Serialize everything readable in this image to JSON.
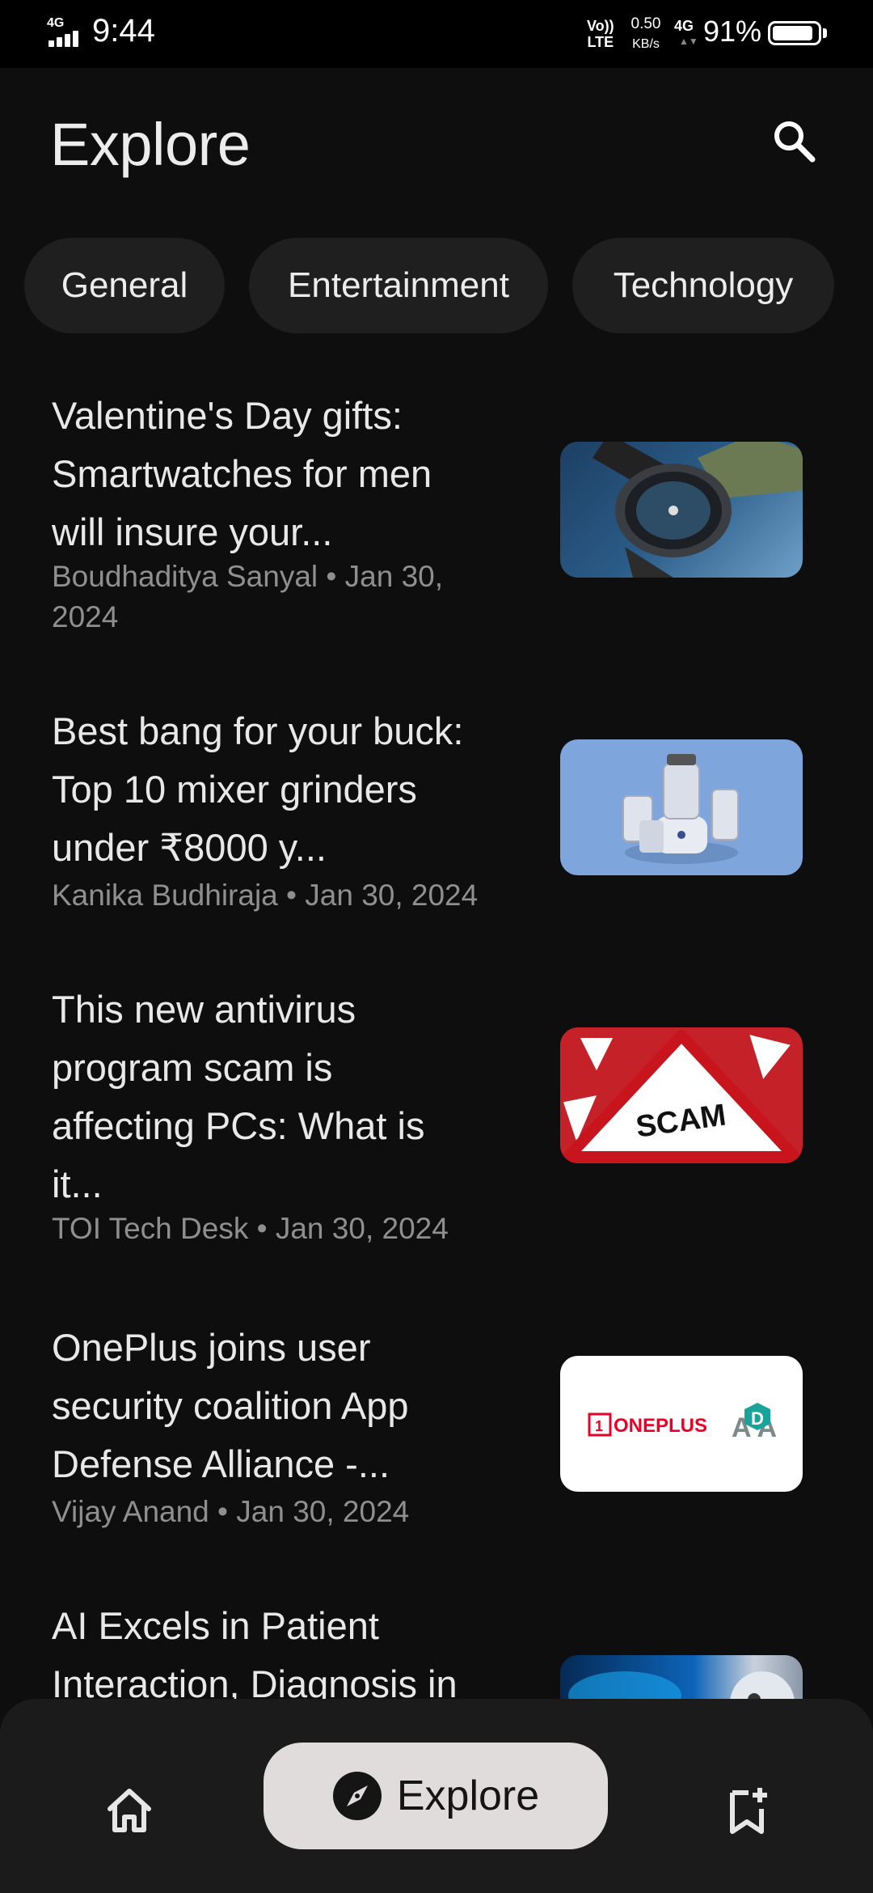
{
  "status_bar": {
    "network": "4G",
    "time": "9:44",
    "volte_top": "Vo))",
    "volte_bottom": "LTE",
    "speed_value": "0.50",
    "speed_unit": "KB/s",
    "network2": "4G",
    "battery_percent": "91%",
    "battery_level": 0.91
  },
  "header": {
    "title": "Explore",
    "search_icon": "search-icon"
  },
  "categories": [
    "General",
    "Entertainment",
    "Technology"
  ],
  "articles": [
    {
      "title_lines": [
        "Valentine's Day gifts:",
        "Smartwatches for men",
        "will insure your..."
      ],
      "meta_lines": [
        "Boudhaditya Sanyal • Jan 30,",
        "2024"
      ],
      "thumb": "smartwatch-image"
    },
    {
      "title_lines": [
        "Best bang for your buck:",
        "Top 10 mixer grinders",
        "under ₹8000 y..."
      ],
      "meta_lines": [
        "Kanika Budhiraja • Jan 30, 2024"
      ],
      "thumb": "mixer-grinder-image"
    },
    {
      "title_lines": [
        "This new antivirus",
        "program scam is",
        "affecting PCs: What is",
        "it..."
      ],
      "meta_lines": [
        "TOI Tech Desk • Jan 30, 2024"
      ],
      "thumb": "scam-sign-image",
      "thumb_text": "SCAM"
    },
    {
      "title_lines": [
        "OnePlus joins user",
        "security coalition App",
        "Defense Alliance -..."
      ],
      "meta_lines": [
        "Vijay Anand • Jan 30, 2024"
      ],
      "thumb": "oneplus-ada-logo-image",
      "thumb_text": "ONEPLUS",
      "thumb_text2": "A  A"
    },
    {
      "title_lines": [
        "AI Excels in Patient",
        "Interaction, Diagnosis in"
      ],
      "meta_lines": [],
      "thumb": "ai-robot-image"
    }
  ],
  "bottom_nav": {
    "home_icon": "home-icon",
    "explore_label": "Explore",
    "explore_icon": "compass-icon",
    "saved_icon": "bookmark-add-icon"
  },
  "colors": {
    "background": "#0e0e0e",
    "chip": "#1f1f1f",
    "nav_background": "#1b1b1b",
    "nav_active_pill": "#e1dcdc",
    "meta_text": "#8f8f8f"
  }
}
